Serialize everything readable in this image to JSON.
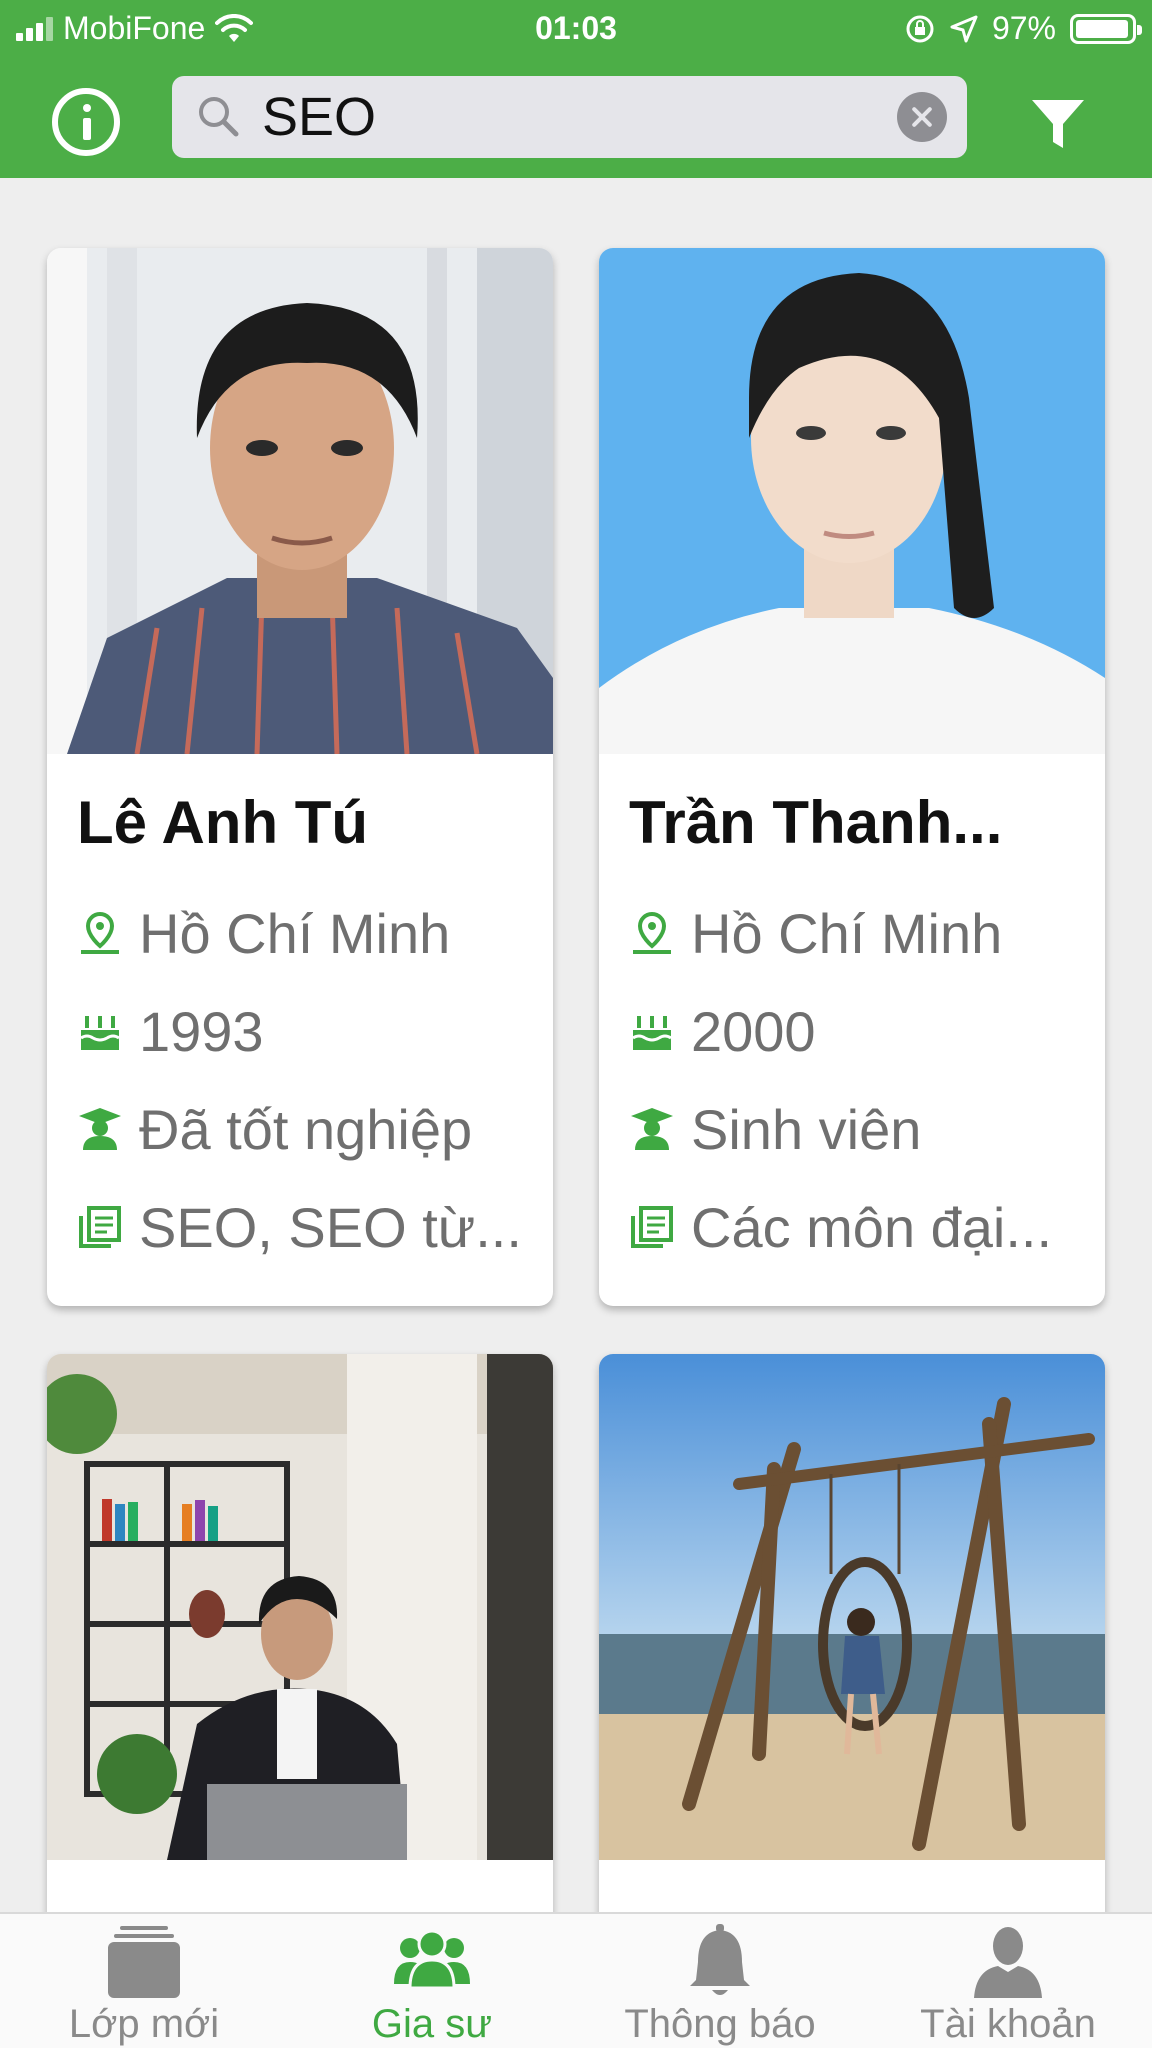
{
  "status_bar": {
    "carrier": "MobiFone",
    "time": "01:03",
    "battery": "97%",
    "battery_level": 0.97
  },
  "search": {
    "value": "SEO",
    "placeholder": ""
  },
  "colors": {
    "accent": "#4cae47",
    "icon_green": "#3fa942",
    "text_gray": "#6f6f6f"
  },
  "icons": {
    "info": "info-icon",
    "search": "search-icon",
    "clear": "clear-icon",
    "filter": "filter-icon",
    "location": "location-icon",
    "birthday": "cake-icon",
    "education": "graduate-icon",
    "subjects": "book-icon"
  },
  "tutors": [
    {
      "name": "Lê Anh Tú",
      "location": "Hồ Chí Minh",
      "year": "1993",
      "status": "Đã tốt nghiệp",
      "subjects": "SEO, SEO từ..."
    },
    {
      "name": "Trần Thanh...",
      "location": "Hồ Chí Minh",
      "year": "2000",
      "status": "Sinh viên",
      "subjects": "Các môn đại..."
    }
  ],
  "tabs": [
    {
      "label": "Lớp mới",
      "icon": "classes-icon",
      "active": false
    },
    {
      "label": "Gia sư",
      "icon": "tutors-icon",
      "active": true
    },
    {
      "label": "Thông báo",
      "icon": "bell-icon",
      "active": false
    },
    {
      "label": "Tài khoản",
      "icon": "account-icon",
      "active": false
    }
  ]
}
